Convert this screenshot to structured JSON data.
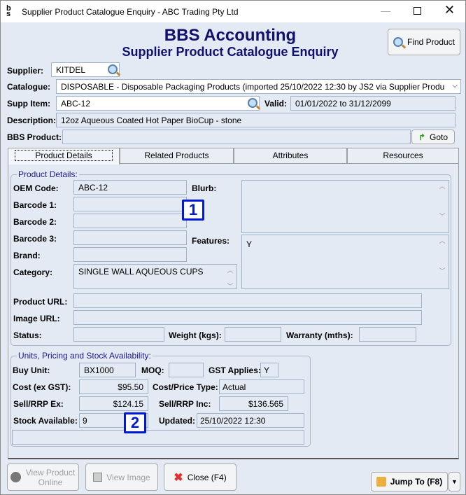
{
  "window": {
    "title": "Supplier Product Catalogue Enquiry - ABC Trading Pty Ltd",
    "app_icon": "bbs-logo-icon"
  },
  "header": {
    "title": "BBS Accounting",
    "subtitle": "Supplier Product Catalogue Enquiry",
    "find_product": "Find Product"
  },
  "form": {
    "supplier_label": "Supplier:",
    "supplier": "KITDEL",
    "catalogue_label": "Catalogue:",
    "catalogue": "DISPOSABLE - Disposable Packaging Products (imported 25/10/2022 12:30 by JS2 via Supplier Produ",
    "supp_item_label": "Supp Item:",
    "supp_item": "ABC-12",
    "valid_label": "Valid:",
    "valid": "01/01/2022 to 31/12/2099",
    "description_label": "Description:",
    "description": "12oz Aqueous Coated Hot Paper BioCup - stone",
    "bbs_product_label": "BBS Product:",
    "bbs_product": "",
    "goto": "Goto"
  },
  "tabs": [
    {
      "label": "Product Details",
      "active": true
    },
    {
      "label": "Related Products"
    },
    {
      "label": "Attributes"
    },
    {
      "label": "Resources"
    }
  ],
  "details": {
    "group_title": "Product Details:",
    "oem_label": "OEM Code:",
    "oem": "ABC-12",
    "barcode1_label": "Barcode 1:",
    "barcode1": "",
    "barcode2_label": "Barcode 2:",
    "barcode2": "",
    "barcode3_label": "Barcode 3:",
    "barcode3": "",
    "brand_label": "Brand:",
    "brand": "",
    "category_label": "Category:",
    "category": "SINGLE WALL AQUEOUS CUPS",
    "blurb_label": "Blurb:",
    "blurb": "",
    "features_label": "Features:",
    "features": "Y",
    "product_url_label": "Product URL:",
    "product_url": "",
    "image_url_label": "Image URL:",
    "image_url": "",
    "status_label": "Status:",
    "status": "",
    "weight_label": "Weight (kgs):",
    "weight": "",
    "warranty_label": "Warranty (mths):",
    "warranty": ""
  },
  "pricing": {
    "group_title": "Units, Pricing and Stock Availability:",
    "buy_unit_label": "Buy Unit:",
    "buy_unit": "BX1000",
    "moq_label": "MOQ:",
    "moq": "",
    "gst_label": "GST Applies:",
    "gst": "Y",
    "cost_label": "Cost (ex GST):",
    "cost": "$95.50",
    "cost_type_label": "Cost/Price Type:",
    "cost_type": "Actual",
    "sell_ex_label": "Sell/RRP Ex:",
    "sell_ex": "$124.15",
    "sell_inc_label": "Sell/RRP Inc:",
    "sell_inc": "$136.565",
    "stock_label": "Stock Available:",
    "stock": "9",
    "updated_label": "Updated:",
    "updated": "25/10/2022 12:30",
    "note": ""
  },
  "markers": [
    "1",
    "2"
  ],
  "footer": {
    "view_online": "View Product Online",
    "view_image": "View Image",
    "close": "Close (F4)",
    "jump_to": "Jump To (F8)"
  },
  "colors": {
    "title": "#10106e",
    "background": "#e3eaf3",
    "marker": "#0019d6"
  }
}
